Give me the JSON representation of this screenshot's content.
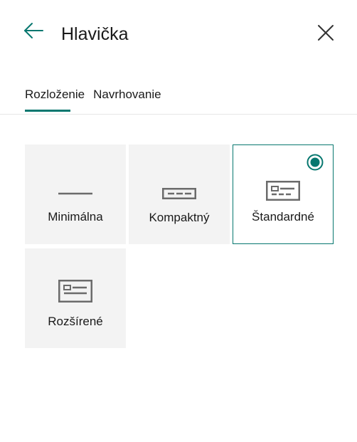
{
  "header": {
    "title": "Hlavička",
    "back_icon": "arrow-left-icon",
    "close_icon": "close-icon"
  },
  "tabs": [
    {
      "label": "Rozloženie",
      "active": true
    },
    {
      "label": "Navrhovanie",
      "active": false
    }
  ],
  "layouts": [
    {
      "label": "Minimálna",
      "icon": "minimal-header-icon",
      "selected": false
    },
    {
      "label": "Kompaktný",
      "icon": "compact-header-icon",
      "selected": false
    },
    {
      "label": "Štandardné",
      "icon": "standard-header-icon",
      "selected": true
    },
    {
      "label": "Rozšírené",
      "icon": "extended-header-icon",
      "selected": false
    }
  ],
  "colors": {
    "accent": "#07776f",
    "card_bg": "#f3f3f3",
    "icon": "#6b6b6b"
  }
}
